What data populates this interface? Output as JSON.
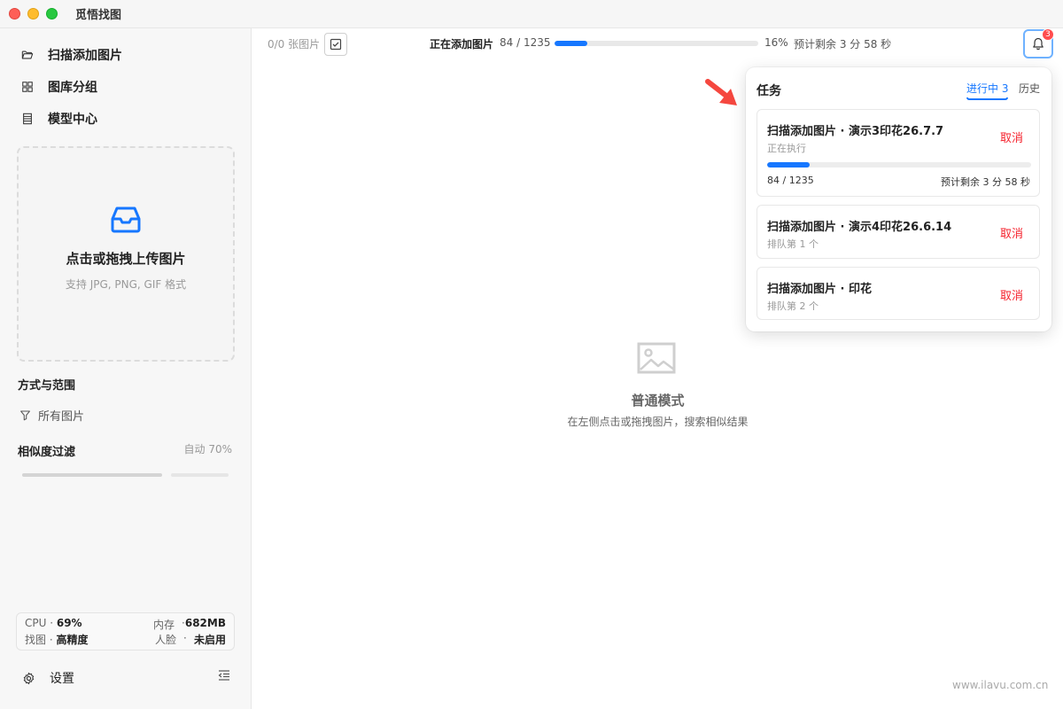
{
  "app": {
    "title": "觅悟找图"
  },
  "sidebar": {
    "nav": [
      {
        "label": "扫描添加图片",
        "icon": "folder-open-icon"
      },
      {
        "label": "图库分组",
        "icon": "grid-icon"
      },
      {
        "label": "模型中心",
        "icon": "model-list-icon"
      }
    ],
    "upload": {
      "title": "点击或拖拽上传图片",
      "subtitle": "支持 JPG, PNG, GIF 格式",
      "icon": "inbox-icon"
    },
    "scope": {
      "title": "方式与范围",
      "filter_label": "所有图片",
      "filter_icon": "filter-icon"
    },
    "similarity": {
      "title": "相似度过滤",
      "value_text": "自动 70%",
      "value": 0.7
    },
    "stats": {
      "cpu_label": "CPU ·",
      "cpu_value": "69%",
      "mem_label": "内存",
      "mem_sep": "·",
      "mem_value": "682MB",
      "search_label": "找图 ·",
      "search_value": "高精度",
      "face_label": "人脸",
      "face_sep": "·",
      "face_value": "未启用"
    },
    "settings_label": "设置"
  },
  "toolbar": {
    "image_count": "0/0 张图片",
    "adding_label": "正在添加图片",
    "adding_count": "84 / 1235",
    "progress_percent": 16,
    "progress_text": "16%",
    "eta": "预计剩余 3 分 58 秒",
    "notification_count": "3"
  },
  "empty_state": {
    "title": "普通模式",
    "subtitle": "在左侧点击或拖拽图片，搜索相似结果",
    "icon": "image-placeholder-icon"
  },
  "task_panel": {
    "title": "任务",
    "tabs": [
      {
        "label": "进行中 3",
        "active": true
      },
      {
        "label": "历史",
        "active": false
      }
    ],
    "tasks": [
      {
        "name": "扫描添加图片 · 演示3印花26.7.7",
        "status": "正在执行",
        "cancel": "取消",
        "count": "84 / 1235",
        "eta": "预计剩余 3 分 58 秒",
        "progress": 0.16
      },
      {
        "name": "扫描添加图片 · 演示4印花26.6.14",
        "status": "排队第 1 个",
        "cancel": "取消"
      },
      {
        "name": "扫描添加图片 · 印花",
        "status": "排队第 2 个",
        "cancel": "取消"
      }
    ]
  },
  "watermark": "www.ilavu.com.cn",
  "colors": {
    "accent": "#1677ff",
    "danger": "#f5222d",
    "badge": "#ff4d4f",
    "arrow": "#f5473f"
  }
}
